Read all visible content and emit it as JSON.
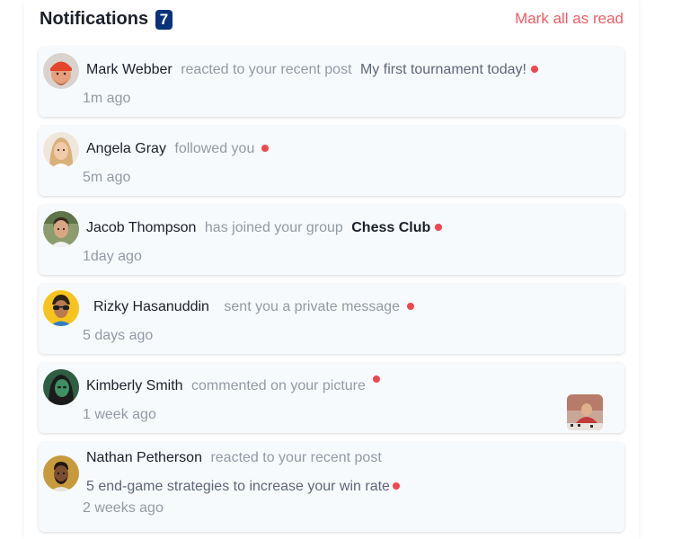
{
  "header": {
    "title": "Notifications",
    "count": "7",
    "mark_all": "Mark all as read"
  },
  "notifications": [
    {
      "name": "Mark Webber",
      "action": "reacted to your recent post",
      "object": "My first tournament today!",
      "time": "1m ago",
      "unread": true
    },
    {
      "name": "Angela Gray",
      "action": "followed you",
      "time": "5m ago",
      "unread": true
    },
    {
      "name": "Jacob Thompson",
      "action": "has joined your group",
      "object": "Chess Club",
      "time": "1day ago",
      "unread": true
    },
    {
      "name": "Rizky Hasanuddin",
      "action": "sent you a private message",
      "time": "5 days ago",
      "unread": true
    },
    {
      "name": "Kimberly Smith",
      "action": "commented on your picture",
      "time": "1 week ago",
      "unread": true
    },
    {
      "name": "Nathan Petherson",
      "action": "reacted to your recent post",
      "object": "5 end-game strategies to increase your win rate",
      "time": "2 weeks ago",
      "unread": true
    }
  ],
  "colors": {
    "accent": "#f05c63",
    "badge": "#0a327b",
    "unread_dot": "#f0474e",
    "item_bg": "#f7fafd",
    "muted": "#939aa5"
  }
}
